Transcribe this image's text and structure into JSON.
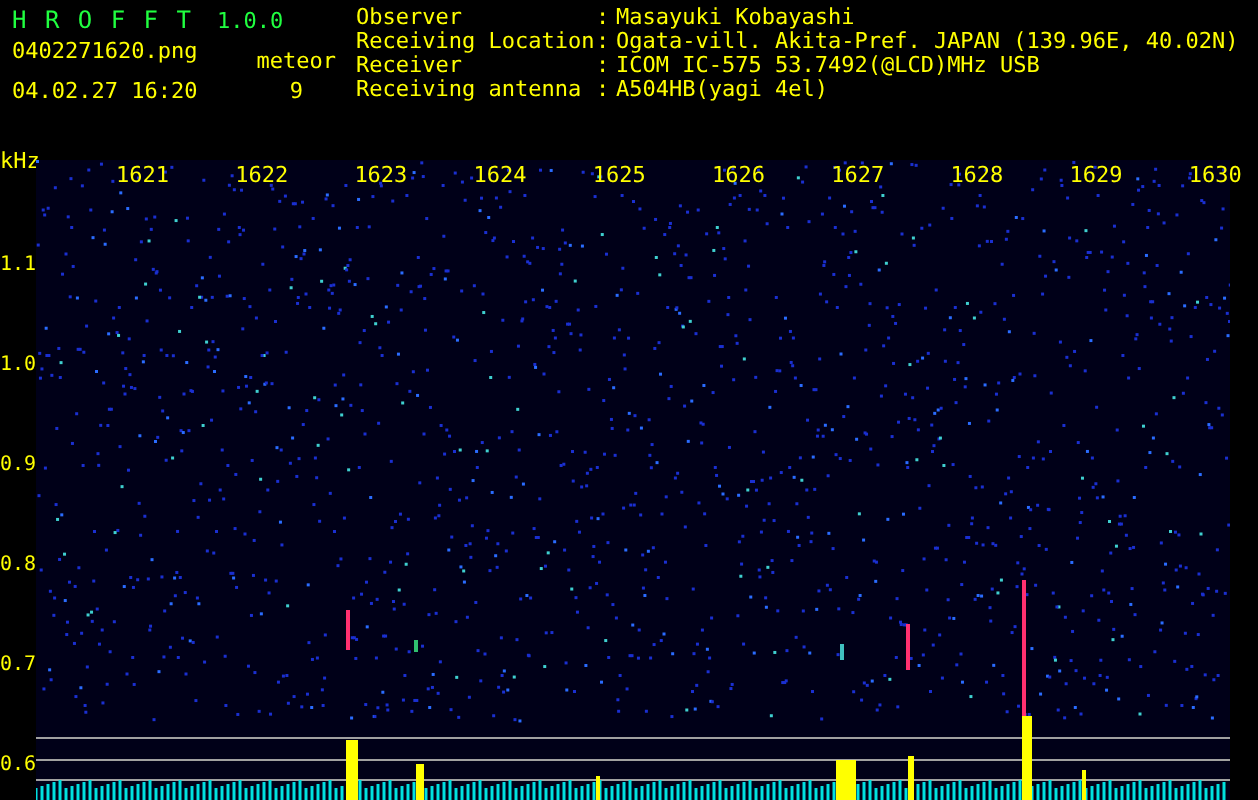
{
  "app": {
    "title": "H R O F F T",
    "version": "1.0.0"
  },
  "capture": {
    "filename": "0402271620.png",
    "datetime": "04.02.27 16:20",
    "meteor_label": "meteor",
    "meteor_count": "9"
  },
  "info": [
    {
      "label": "Observer",
      "separator": ":",
      "value": "Masayuki Kobayashi"
    },
    {
      "label": "Receiving Location",
      "separator": ":",
      "value": "Ogata-vill. Akita-Pref. JAPAN (139.96E, 40.02N)"
    },
    {
      "label": "Receiver",
      "separator": ":",
      "value": "ICOM IC-575 53.7492(@LCD)MHz USB"
    },
    {
      "label": "Receiving antenna",
      "separator": ":",
      "value": "A504HB(yagi 4el)"
    }
  ],
  "y_axis": {
    "unit": "kHz",
    "ticks": [
      "1.1",
      "1.0",
      "0.9",
      "0.8",
      "0.7",
      "0.6"
    ]
  },
  "x_axis": {
    "ticks": [
      "1621",
      "1622",
      "1623",
      "1624",
      "1625",
      "1626",
      "1627",
      "1628",
      "1629",
      "1630"
    ]
  }
}
